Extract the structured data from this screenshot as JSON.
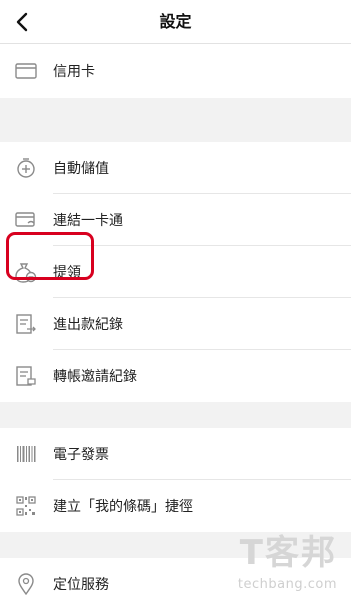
{
  "header": {
    "title": "設定"
  },
  "sections": [
    {
      "items": [
        {
          "label": "信用卡",
          "icon": "credit-card-icon"
        }
      ]
    },
    {
      "items": [
        {
          "label": "自動儲值",
          "icon": "auto-topup-icon"
        },
        {
          "label": "連結一卡通",
          "icon": "link-card-icon"
        },
        {
          "label": "提領",
          "icon": "withdraw-icon"
        },
        {
          "label": "進出款紀錄",
          "icon": "transaction-record-icon"
        },
        {
          "label": "轉帳邀請紀錄",
          "icon": "transfer-invite-record-icon"
        }
      ]
    },
    {
      "items": [
        {
          "label": "電子發票",
          "icon": "barcode-icon"
        },
        {
          "label": "建立「我的條碼」捷徑",
          "icon": "qr-code-icon"
        }
      ]
    },
    {
      "items": [
        {
          "label": "定位服務",
          "icon": "location-pin-icon"
        }
      ]
    }
  ],
  "watermark": {
    "main": "T客邦",
    "sub": "techbang.com"
  },
  "colors": {
    "highlight": "#d8001f",
    "gap": "#f2f2f2",
    "icon": "#8a8a8a"
  }
}
